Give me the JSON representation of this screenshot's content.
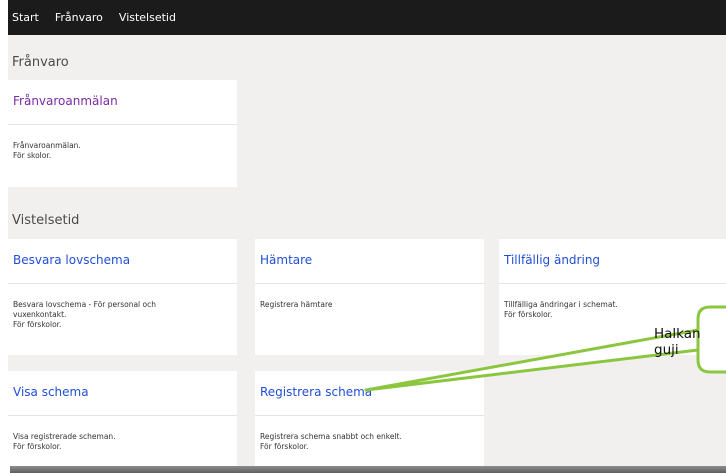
{
  "topbar": {
    "items": [
      "Start",
      "Frånvaro",
      "Vistelsetid"
    ]
  },
  "sections": {
    "franvaro": "Frånvaro",
    "vistelsetid": "Vistelsetid"
  },
  "cards": {
    "franvaroanmalan": {
      "title": "Frånvaroanmälan",
      "desc1": "Frånvaroanmälan.",
      "desc2": "För skolor."
    },
    "besvara_lovschema": {
      "title": "Besvara lovschema",
      "desc1": "Besvara lovschema - För personal och",
      "desc2": "vuxenkontakt.",
      "desc3": "För förskolor."
    },
    "hamtare": {
      "title": "Hämtare",
      "desc1": "Registrera hämtare"
    },
    "tillfallig_andring": {
      "title": "Tillfällig ändring",
      "desc1": "Tillfälliga ändringar i schemat.",
      "desc2": "För förskolor."
    },
    "visa_schema": {
      "title": "Visa schema",
      "desc1": "Visa registrerade scheman.",
      "desc2": "För förskolor."
    },
    "registrera_schema": {
      "title": "Registrera schema",
      "desc1": "Registrera schema snabbt och enkelt.",
      "desc2": "För förskolor."
    }
  },
  "callout": {
    "text": "Halkan guji"
  },
  "colors": {
    "topbar": "#1b1b1b",
    "background": "#f1f0ee",
    "purple_link": "#7a2ca3",
    "blue_link": "#1f4fd6",
    "callout_border": "#8cc63f"
  }
}
